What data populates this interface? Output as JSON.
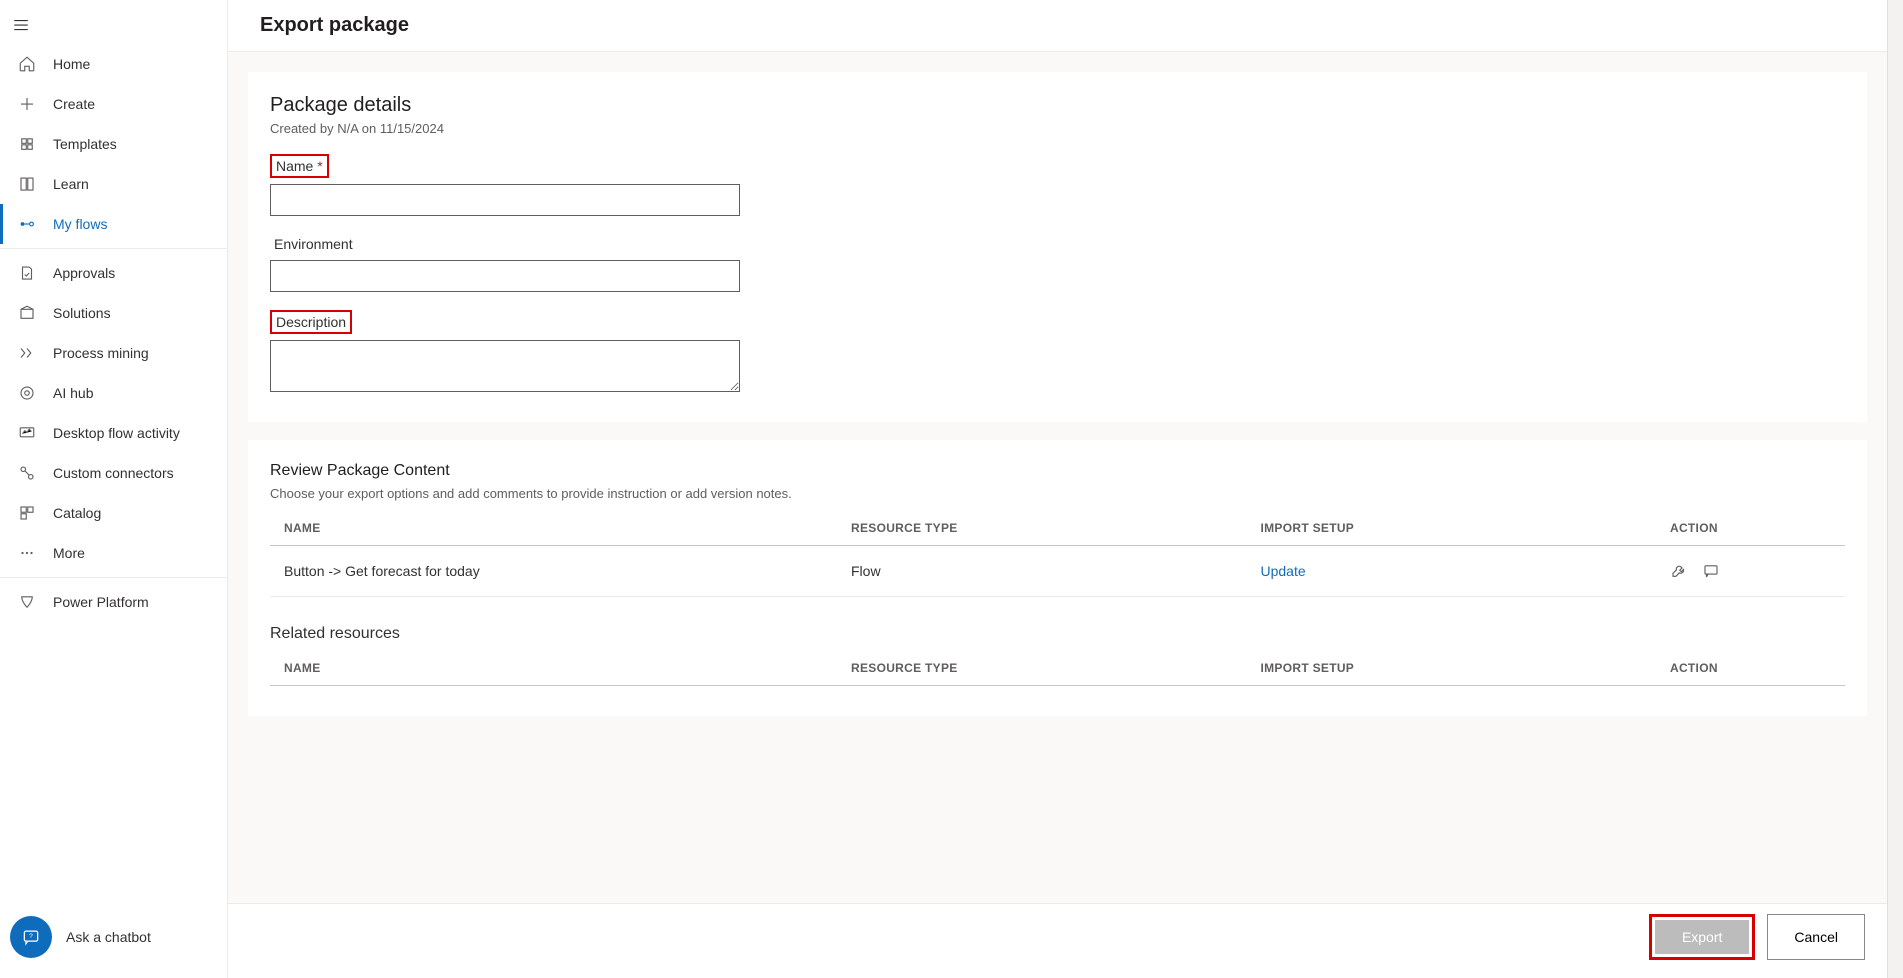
{
  "sidebar": {
    "items": [
      {
        "label": "Home",
        "icon": "home"
      },
      {
        "label": "Create",
        "icon": "plus"
      },
      {
        "label": "Templates",
        "icon": "templates"
      },
      {
        "label": "Learn",
        "icon": "book"
      },
      {
        "label": "My flows",
        "icon": "flow",
        "active": true
      },
      {
        "label": "Approvals",
        "icon": "approvals"
      },
      {
        "label": "Solutions",
        "icon": "solutions"
      },
      {
        "label": "Process mining",
        "icon": "process"
      },
      {
        "label": "AI hub",
        "icon": "ai"
      },
      {
        "label": "Desktop flow activity",
        "icon": "desktop"
      },
      {
        "label": "Custom connectors",
        "icon": "connectors"
      },
      {
        "label": "Catalog",
        "icon": "catalog"
      },
      {
        "label": "More",
        "icon": "more"
      },
      {
        "label": "Power Platform",
        "icon": "platform"
      }
    ],
    "chatbot_label": "Ask a chatbot"
  },
  "header": {
    "title": "Export package"
  },
  "package": {
    "title": "Package details",
    "subtitle": "Created by N/A on 11/15/2024",
    "name_label": "Name",
    "name_value": "",
    "env_label": "Environment",
    "env_value": "",
    "desc_label": "Description",
    "desc_value": ""
  },
  "review": {
    "title": "Review Package Content",
    "subtitle": "Choose your export options and add comments to provide instruction or add version notes.",
    "columns": {
      "name": "NAME",
      "type": "RESOURCE TYPE",
      "import": "IMPORT SETUP",
      "action": "ACTION"
    },
    "rows": [
      {
        "name": "Button -> Get forecast for today",
        "type": "Flow",
        "import": "Update"
      }
    ],
    "related_title": "Related resources"
  },
  "footer": {
    "export": "Export",
    "cancel": "Cancel"
  }
}
